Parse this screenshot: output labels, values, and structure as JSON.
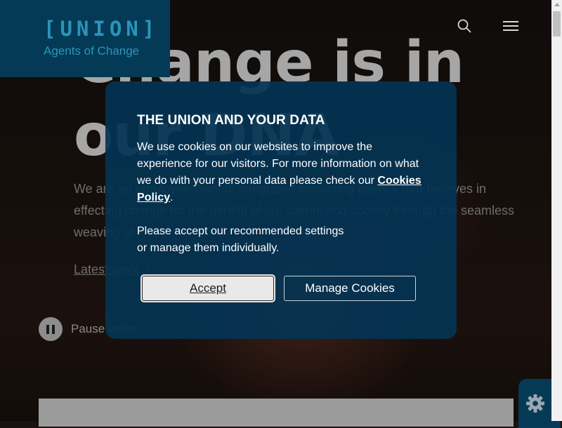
{
  "brand": {
    "logo_word": "[UNION]",
    "tagline": "Agents of Change"
  },
  "header": {
    "search_icon": "search-icon",
    "menu_icon": "hamburger-menu-icon"
  },
  "hero": {
    "headline": "Change is in our DNA",
    "intro": "We are an employee-owned, integrated marketing agency that believes in effecting change for the benefit of our clients and society through the seamless weaving of",
    "latest_link": "Latest work",
    "latest_arrow": "↓",
    "pause_label": "Pause video"
  },
  "cookie_modal": {
    "title": "THE UNION AND YOUR DATA",
    "body_part1": "We use cookies on our websites to improve the experience for our visitors. For more information on what we do with your personal data please check our ",
    "policy_link": "Cookies Policy",
    "body_part1_end": ".",
    "body_part2_line1": "Please accept our recommended settings",
    "body_part2_line2": "or manage them individually.",
    "accept_label": "Accept",
    "manage_label": "Manage Cookies"
  },
  "colors": {
    "brand_navy": "#053a57",
    "brand_cyan": "#2a95b9",
    "modal_bg": "#043453"
  }
}
